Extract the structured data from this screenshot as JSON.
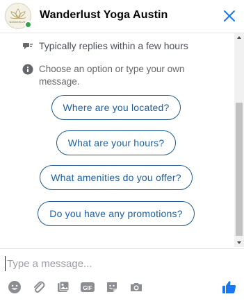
{
  "header": {
    "avatar_alt": "Wanderlust logo",
    "title": "Wanderlust Yoga Austin",
    "close_icon": "close-icon"
  },
  "info": {
    "reply_time": "Typically replies within a few hours",
    "instruction": "Choose an option or type your own message."
  },
  "quick_replies": [
    "Where are you located?",
    "What are your hours?",
    "What amenities do you offer?",
    "Do you have any promotions?"
  ],
  "composer": {
    "placeholder": "Type a message...",
    "value": "",
    "tools": [
      "emoji-icon",
      "attachment-icon",
      "photo-icon",
      "gif-icon",
      "sticker-icon",
      "camera-icon"
    ],
    "send_icon": "thumbs-up-icon"
  },
  "colors": {
    "accent": "#1877f2",
    "quick_reply_border": "#1e5a8e",
    "quick_reply_text": "#1c5fa3",
    "online": "#31a24c",
    "icon_gray": "#8a8d91"
  }
}
